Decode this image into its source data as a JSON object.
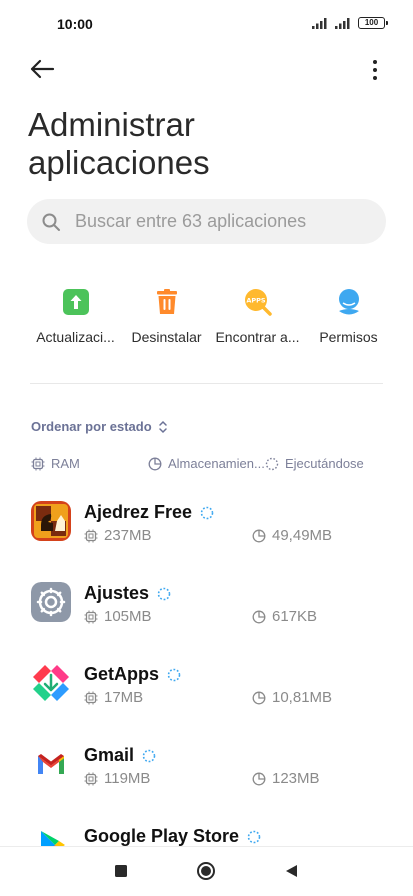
{
  "status_bar": {
    "time": "10:00",
    "battery": "100"
  },
  "header": {
    "title_line1": "Administrar",
    "title_line2": "aplicaciones"
  },
  "search": {
    "placeholder": "Buscar entre 63 aplicaciones"
  },
  "actions": [
    {
      "label": "Actualizaci...",
      "icon": "update-icon",
      "color": "#4cc35a"
    },
    {
      "label": "Desinstalar",
      "icon": "trash-icon",
      "color": "#ff8a2b"
    },
    {
      "label": "Encontrar a...",
      "icon": "apps-search-icon",
      "color": "#ffb92e"
    },
    {
      "label": "Permisos",
      "icon": "permissions-icon",
      "color": "#3ea8f0"
    }
  ],
  "sort": {
    "label": "Ordenar por estado"
  },
  "legend": {
    "ram": "RAM",
    "storage": "Almacenamien...",
    "running": "Ejecutándose"
  },
  "apps": [
    {
      "name": "Ajedrez Free",
      "ram": "237MB",
      "storage": "49,49MB",
      "icon": "chess-icon"
    },
    {
      "name": "Ajustes",
      "ram": "105MB",
      "storage": "617KB",
      "icon": "settings-gear-icon"
    },
    {
      "name": "GetApps",
      "ram": "17MB",
      "storage": "10,81MB",
      "icon": "getapps-icon"
    },
    {
      "name": "Gmail",
      "ram": "119MB",
      "storage": "123MB",
      "icon": "gmail-icon"
    },
    {
      "name": "Google Play Store",
      "ram": "",
      "storage": "",
      "icon": "play-store-icon"
    }
  ],
  "colors": {
    "accent_text": "#6b7296",
    "running_indicator": "#3ea8f0"
  }
}
